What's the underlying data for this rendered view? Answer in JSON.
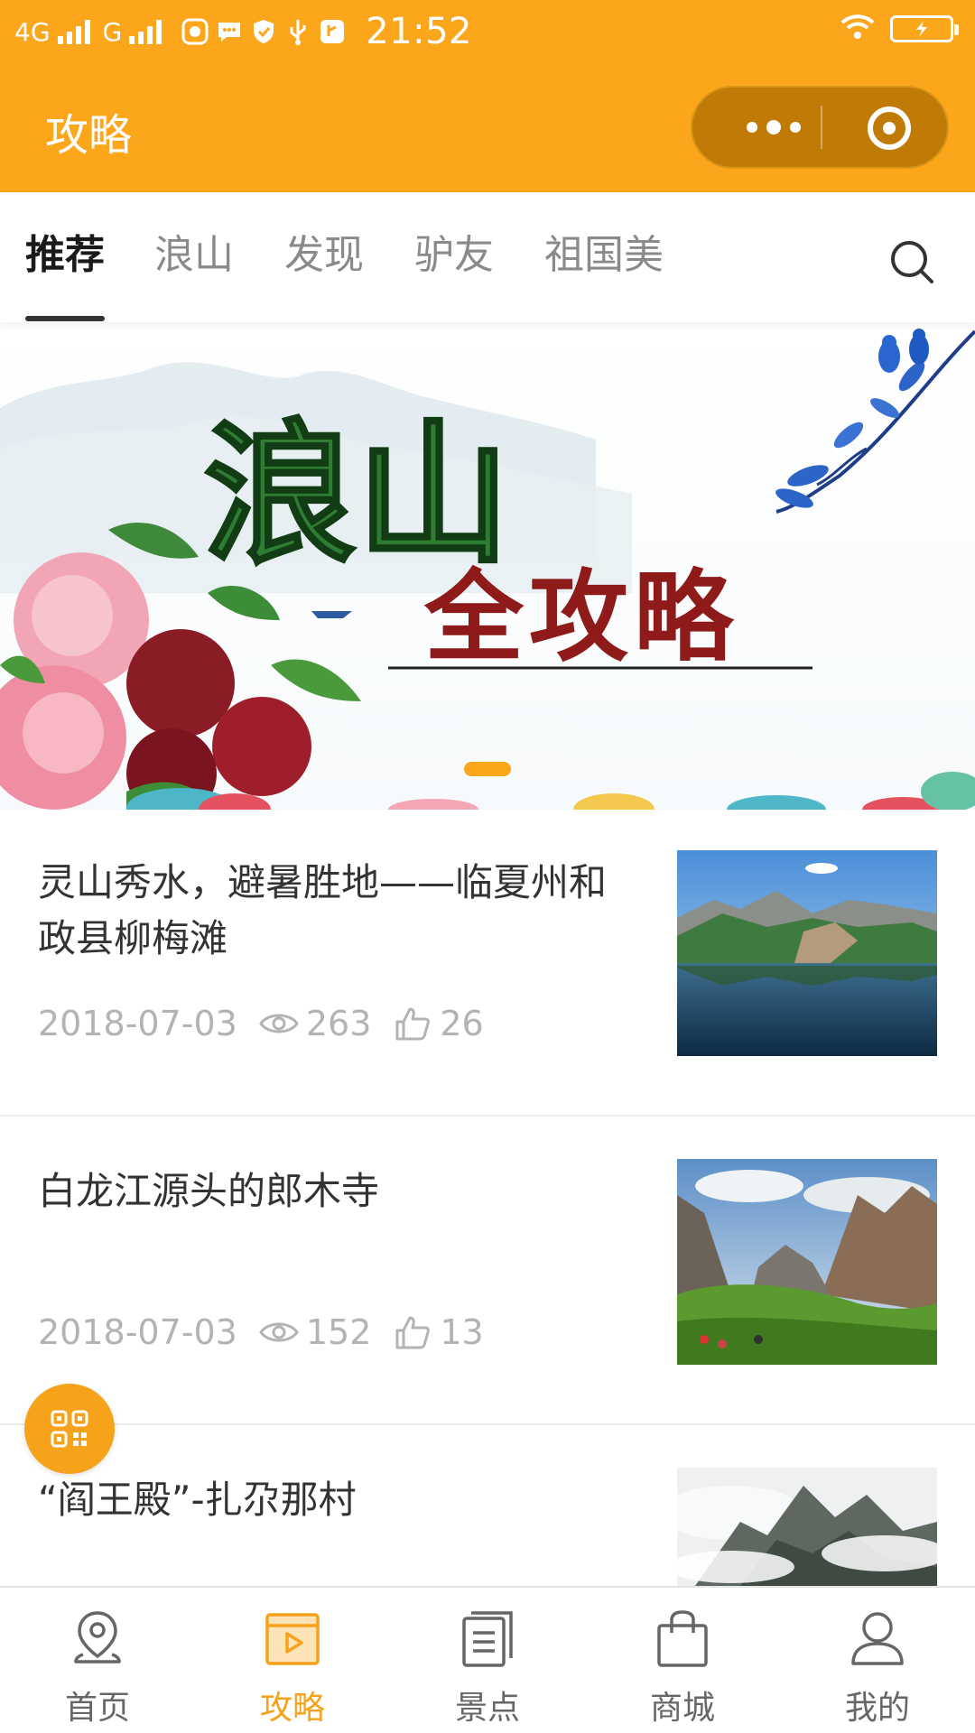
{
  "status_bar": {
    "network_1": "4G",
    "network_2": "G",
    "time": "21:52",
    "icons": [
      "browser-icon",
      "message-icon",
      "shield-icon",
      "usb-icon",
      "usb-debug-icon",
      "wifi-icon",
      "battery-charging-icon"
    ]
  },
  "header": {
    "title": "攻略",
    "background_color": "#fba61b",
    "capsule_icons": [
      "more-icon",
      "close-target-icon"
    ]
  },
  "tabs": {
    "items": [
      {
        "label": "推荐",
        "active": true
      },
      {
        "label": "浪山",
        "active": false
      },
      {
        "label": "发现",
        "active": false
      },
      {
        "label": "驴友",
        "active": false
      },
      {
        "label": "祖国美",
        "active": false
      }
    ],
    "search_icon": "search-icon"
  },
  "banner": {
    "line_1": "浪山",
    "line_2": "全攻略",
    "current_slide": 1
  },
  "articles": [
    {
      "title": "灵山秀水，避暑胜地——临夏州和政县柳梅滩",
      "date": "2018-07-03",
      "views": "263",
      "likes": "26"
    },
    {
      "title": "白龙江源头的郎木寺",
      "date": "2018-07-03",
      "views": "152",
      "likes": "13"
    },
    {
      "title": "“阎王殿”-扎尕那村",
      "date": "",
      "views": "",
      "likes": ""
    }
  ],
  "qr_button": {
    "icon": "qr-code-icon"
  },
  "bottom_nav": {
    "items": [
      {
        "label": "首页",
        "icon": "location-icon",
        "active": false
      },
      {
        "label": "攻略",
        "icon": "video-icon",
        "active": true
      },
      {
        "label": "景点",
        "icon": "list-icon",
        "active": false
      },
      {
        "label": "商城",
        "icon": "bag-icon",
        "active": false
      },
      {
        "label": "我的",
        "icon": "user-icon",
        "active": false
      }
    ],
    "active_color": "#f6a21a"
  }
}
